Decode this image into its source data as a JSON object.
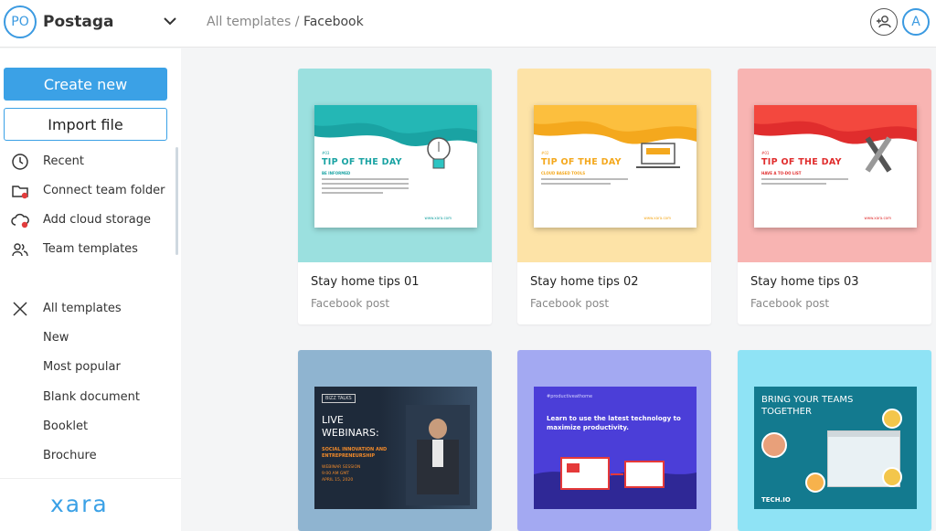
{
  "workspace": {
    "initials": "PO",
    "name": "Postaga"
  },
  "breadcrumb": {
    "parent": "All templates",
    "separator": " / ",
    "current": "Facebook"
  },
  "user": {
    "initials": "A"
  },
  "sidebar": {
    "create_label": "Create new",
    "import_label": "Import file",
    "items": [
      {
        "label": "Recent",
        "icon": "clock-icon"
      },
      {
        "label": "Connect team folder",
        "icon": "folder-icon"
      },
      {
        "label": "Add cloud storage",
        "icon": "cloud-icon"
      },
      {
        "label": "Team templates",
        "icon": "team-icon"
      }
    ],
    "categories": [
      {
        "label": "All templates",
        "icon": "close-icon"
      },
      {
        "label": "New"
      },
      {
        "label": "Most popular"
      },
      {
        "label": "Blank document"
      },
      {
        "label": "Booklet"
      },
      {
        "label": "Brochure"
      }
    ],
    "logo": "xara"
  },
  "colors": {
    "accent": "#3ba1e6",
    "teal": "#9be0df",
    "yellow": "#fde3a7",
    "pink": "#f8b4b2",
    "steel": "#8fb4d0",
    "periwinkle": "#a3a9f2",
    "sky": "#8fe3f5"
  },
  "templates": [
    {
      "title": "Stay home tips 01",
      "subtitle": "Facebook post",
      "thumb": {
        "kicker": "#03",
        "header": "TIP OF THE DAY",
        "subheader": "BE INFORMED",
        "url": "www.xara.com",
        "accent": "#1aa3a3"
      }
    },
    {
      "title": "Stay home tips 02",
      "subtitle": "Facebook post",
      "thumb": {
        "kicker": "#02",
        "header": "TIP OF THE DAY",
        "subheader": "CLOUD BASED TOOLS",
        "url": "www.xara.com",
        "accent": "#f4a81d"
      }
    },
    {
      "title": "Stay home tips 03",
      "subtitle": "Facebook post",
      "thumb": {
        "kicker": "#01",
        "header": "TIP OF THE DAY",
        "subheader": "HAVE A TO-DO LIST",
        "url": "www.xara.com",
        "accent": "#e02d2d"
      }
    },
    {
      "thumb": {
        "badge": "BIZZ TALKS",
        "headline1": "LIVE",
        "headline2": "WEBINARS:",
        "topic": "SOCIAL INNOVATION AND ENTREPRENEURSHIP",
        "session": "WEBINAR SESSION",
        "time": "9:00 AM GMT",
        "date": "APRIL 15, 2020"
      }
    },
    {
      "thumb": {
        "hashtag": "#productiveathome",
        "headline": "Learn to use the latest technology to maximize productivity."
      }
    },
    {
      "thumb": {
        "headline": "BRING YOUR TEAMS TOGETHER",
        "brand": "TECH.IO"
      }
    }
  ]
}
